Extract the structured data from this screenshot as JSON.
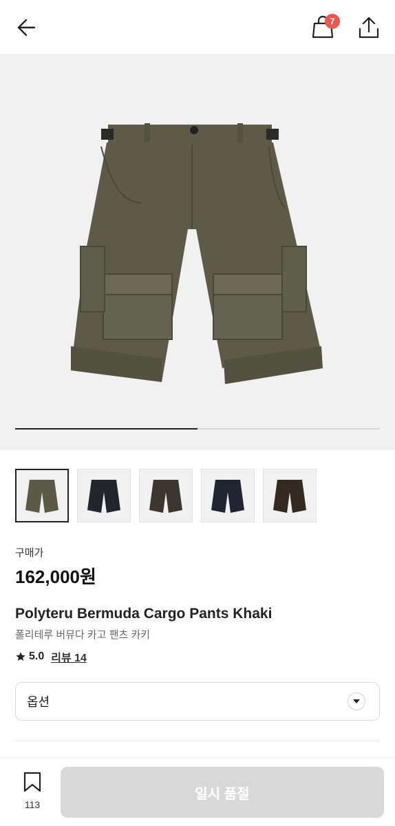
{
  "header": {
    "cart_count": "7"
  },
  "gallery": {
    "progress": 0.5,
    "thumbnails": [
      {
        "color": "#5b5a47",
        "label": "khaki"
      },
      {
        "color": "#22252b",
        "label": "black"
      },
      {
        "color": "#3b372e",
        "label": "brown"
      },
      {
        "color": "#1f2430",
        "label": "navy"
      },
      {
        "color": "#33291f",
        "label": "dark-brown"
      }
    ]
  },
  "product": {
    "price_label": "구매가",
    "price": "162,000원",
    "title": "Polyteru Bermuda Cargo Pants Khaki",
    "subtitle": "폴리테루 버뮤다 카고 팬츠 카키",
    "rating": "5.0",
    "review_label": "리뷰 14"
  },
  "option": {
    "label": "옵션"
  },
  "footer": {
    "bookmark_count": "113",
    "action_label": "일시 품절"
  },
  "colors": {
    "khaki": "#5d5b48",
    "soldout_bg": "#d9d9d9",
    "badge": "#e85a4f"
  }
}
